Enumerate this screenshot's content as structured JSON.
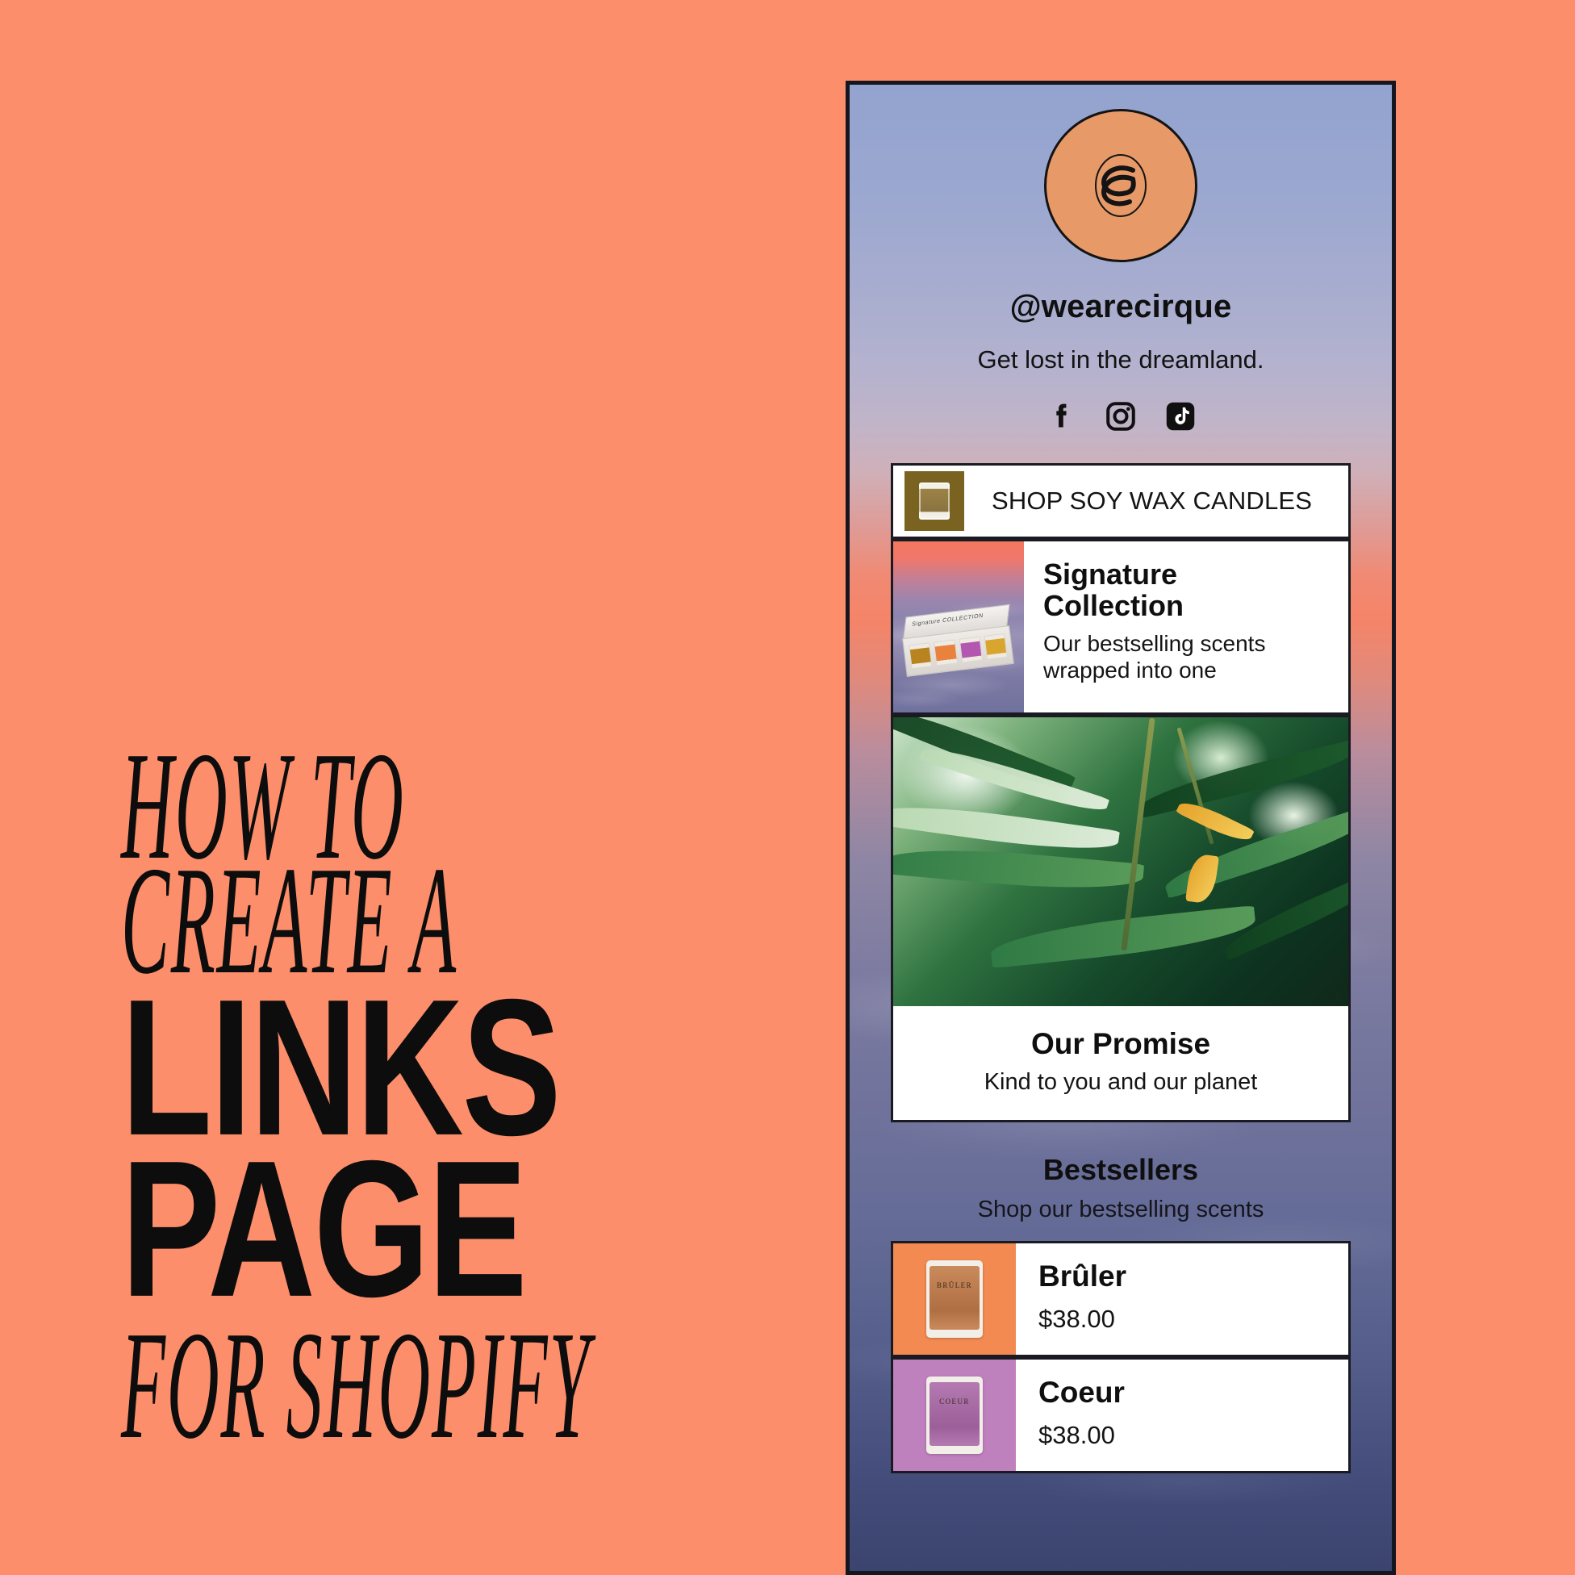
{
  "poster": {
    "background_color": "#fd8e6b",
    "headline_lines": [
      {
        "text": "HOW TO",
        "style": "serif-italic"
      },
      {
        "text": "CREATE A",
        "style": "serif-italic"
      },
      {
        "text": "LINKS",
        "style": "sans-bold"
      },
      {
        "text": "PAGE",
        "style": "sans-bold"
      },
      {
        "text": "FOR SHOPIFY",
        "style": "serif-italic"
      }
    ]
  },
  "phone": {
    "frame_color": "#161620",
    "background_gradient": [
      "#93a3cf",
      "#f58468",
      "#7c7ba0",
      "#3b446e"
    ]
  },
  "profile": {
    "avatar_icon": "cirque-monogram-logo",
    "avatar_color": "#e79a68",
    "handle": "@wearecirque",
    "tagline": "Get lost in the dreamland.",
    "socials": [
      {
        "name": "facebook-icon",
        "label": "Facebook"
      },
      {
        "name": "instagram-icon",
        "label": "Instagram"
      },
      {
        "name": "tiktok-icon",
        "label": "TikTok"
      }
    ]
  },
  "links": {
    "shop_candles": {
      "label": "SHOP SOY WAX CANDLES",
      "thumb_color": "#7a6320",
      "thumb_icon": "candle-jar-thumbnail"
    },
    "signature": {
      "title_line1": "Signature",
      "title_line2": "Collection",
      "subtitle_line1": "Our bestselling scents",
      "subtitle_line2": "wrapped into one",
      "box_label": "Signature COLLECTION",
      "candle_colors": [
        "#b98320",
        "#e8823c",
        "#b357b0",
        "#d8a52e"
      ]
    },
    "promise": {
      "title": "Our Promise",
      "subtitle": "Kind to you and our planet",
      "image_alt": "green-leaves-photo"
    }
  },
  "bestsellers": {
    "title": "Bestsellers",
    "subtitle": "Shop our bestselling scents",
    "products": [
      {
        "name": "Brûler",
        "price": "$38.00",
        "tile_color": "#f28a52",
        "wax_color": "#c07a4e",
        "jar_label": "BRÛLER"
      },
      {
        "name": "Coeur",
        "price": "$38.00",
        "tile_color": "#bf81bd",
        "wax_color": "#a36aa0",
        "jar_label": "COEUR"
      }
    ]
  }
}
